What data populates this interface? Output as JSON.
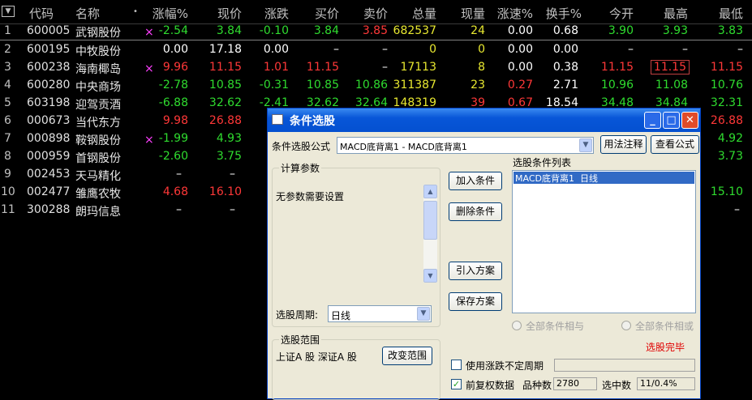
{
  "header": {
    "menu_glyph": "▼",
    "columns": [
      "代码",
      "名称",
      "•",
      "涨幅%",
      "现价",
      "涨跌",
      "买价",
      "卖价",
      "总量",
      "现量",
      "涨速%",
      "换手%",
      "今开",
      "最高",
      "最低"
    ]
  },
  "rows": [
    {
      "idx": "1",
      "code": "600005",
      "name": "武钢股份",
      "mark": "×",
      "chg": "-2.54",
      "price": "3.84",
      "diff": "-0.10",
      "bid": "3.84",
      "ask": "3.85",
      "vol": "682537",
      "cur": "24",
      "speed": "0.00",
      "turn": "0.68",
      "open": "3.90",
      "high": "3.93",
      "low": "3.83"
    },
    {
      "idx": "2",
      "code": "600195",
      "name": "中牧股份",
      "mark": "",
      "chg": "0.00",
      "price": "17.18",
      "diff": "0.00",
      "bid": "–",
      "ask": "–",
      "vol": "0",
      "cur": "0",
      "speed": "0.00",
      "turn": "0.00",
      "open": "–",
      "high": "–",
      "low": "–"
    },
    {
      "idx": "3",
      "code": "600238",
      "name": "海南椰岛",
      "mark": "×",
      "chg": "9.96",
      "price": "11.15",
      "diff": "1.01",
      "bid": "11.15",
      "ask": "–",
      "vol": "17113",
      "cur": "8",
      "speed": "0.00",
      "turn": "0.38",
      "open": "11.15",
      "high": "11.15",
      "low": "11.15"
    },
    {
      "idx": "4",
      "code": "600280",
      "name": "中央商场",
      "mark": "",
      "chg": "-2.78",
      "price": "10.85",
      "diff": "-0.31",
      "bid": "10.85",
      "ask": "10.86",
      "vol": "311387",
      "cur": "23",
      "speed": "0.27",
      "turn": "2.71",
      "open": "10.96",
      "high": "11.08",
      "low": "10.76"
    },
    {
      "idx": "5",
      "code": "603198",
      "name": "迎驾贡酒",
      "mark": "",
      "chg": "-6.88",
      "price": "32.62",
      "diff": "-2.41",
      "bid": "32.62",
      "ask": "32.64",
      "vol": "148319",
      "cur": "39",
      "speed": "0.67",
      "turn": "18.54",
      "open": "34.48",
      "high": "34.84",
      "low": "32.31"
    },
    {
      "idx": "6",
      "code": "000673",
      "name": "当代东方",
      "mark": "",
      "chg": "9.98",
      "price": "26.88",
      "low": "26.88"
    },
    {
      "idx": "7",
      "code": "000898",
      "name": "鞍钢股份",
      "mark": "×",
      "chg": "-1.99",
      "price": "4.93",
      "low": "4.92"
    },
    {
      "idx": "8",
      "code": "000959",
      "name": "首钢股份",
      "mark": "",
      "chg": "-2.60",
      "price": "3.75",
      "low": "3.73"
    },
    {
      "idx": "9",
      "code": "002453",
      "name": "天马精化",
      "mark": "",
      "chg": "–",
      "price": "–",
      "low": ""
    },
    {
      "idx": "10",
      "code": "002477",
      "name": "雏鹰农牧",
      "mark": "",
      "chg": "4.68",
      "price": "16.10",
      "low": "15.10"
    },
    {
      "idx": "11",
      "code": "300288",
      "name": "朗玛信息",
      "mark": "",
      "chg": "–",
      "price": "–",
      "low": "–"
    }
  ],
  "dialog": {
    "title": "条件选股",
    "formula_label": "条件选股公式",
    "formula_value": "MACD底背离1  - MACD底背离1",
    "usage_btn": "用法注释",
    "view_btn": "查看公式",
    "params_group": "计算参数",
    "params_text": "无参数需要设置",
    "period_label": "选股周期:",
    "period_value": "日线",
    "add_btn": "加入条件",
    "del_btn": "删除条件",
    "import_btn": "引入方案",
    "save_btn": "保存方案",
    "list_label": "选股条件列表",
    "list_item": "MACD底背离1  日线",
    "radio_and": "全部条件相与",
    "radio_or": "全部条件相或",
    "status": "选股完毕",
    "range_group": "选股范围",
    "range_text": "上证A 股 深证A 股",
    "change_range_btn": "改变范围",
    "use_period_label": "使用涨跌不定周期",
    "adjust_label": "前复权数据",
    "count_label": "品种数",
    "count_value": "2780",
    "selected_label": "选中数",
    "selected_value": "11/0.4%"
  }
}
